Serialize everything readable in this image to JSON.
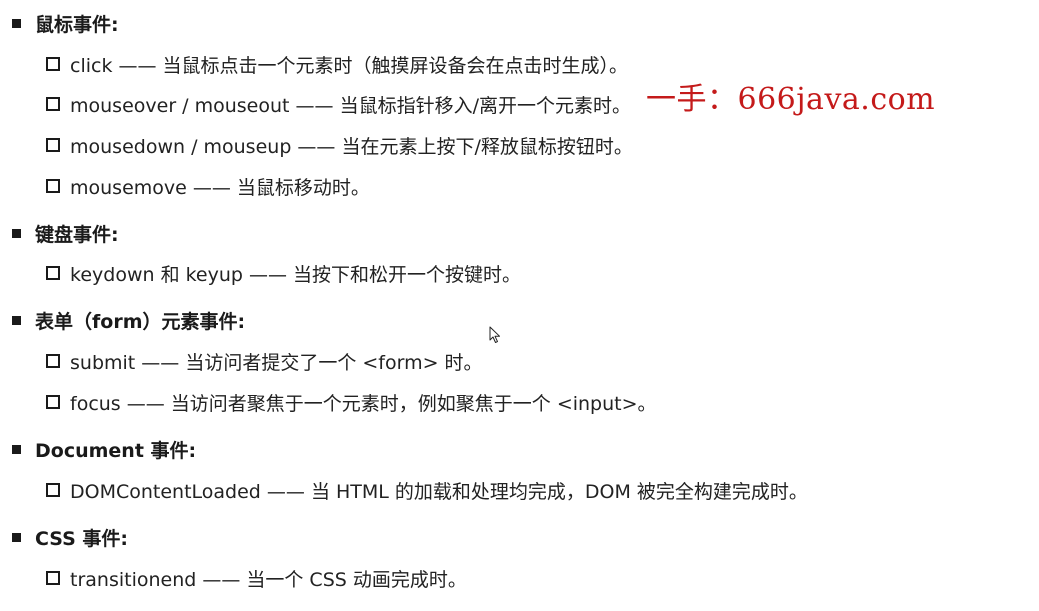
{
  "sections": [
    {
      "heading": "鼠标事件:",
      "items": [
        "click —— 当鼠标点击一个元素时（触摸屏设备会在点击时生成）。",
        "mouseover / mouseout —— 当鼠标指针移入/离开一个元素时。",
        "mousedown / mouseup —— 当在元素上按下/释放鼠标按钮时。",
        "mousemove —— 当鼠标移动时。"
      ]
    },
    {
      "heading": "键盘事件:",
      "items": [
        "keydown 和 keyup —— 当按下和松开一个按键时。"
      ]
    },
    {
      "heading": "表单（form）元素事件:",
      "items": [
        "submit —— 当访问者提交了一个 <form> 时。",
        "focus —— 当访问者聚焦于一个元素时，例如聚焦于一个 <input>。"
      ]
    },
    {
      "heading": "Document 事件:",
      "items": [
        "DOMContentLoaded —— 当 HTML 的加载和处理均完成，DOM 被完全构建完成时。"
      ]
    },
    {
      "heading": "CSS 事件:",
      "items": [
        "transitionend —— 当一个 CSS 动画完成时。"
      ]
    }
  ],
  "watermark": "一手：666java.com",
  "icons": {
    "heading_bullet": "filled-square-bullet-icon",
    "item_bullet": "hollow-square-bullet-icon",
    "cursor": "mouse-pointer-icon"
  },
  "colors": {
    "text": "#222222",
    "watermark": "#c41a1a"
  }
}
